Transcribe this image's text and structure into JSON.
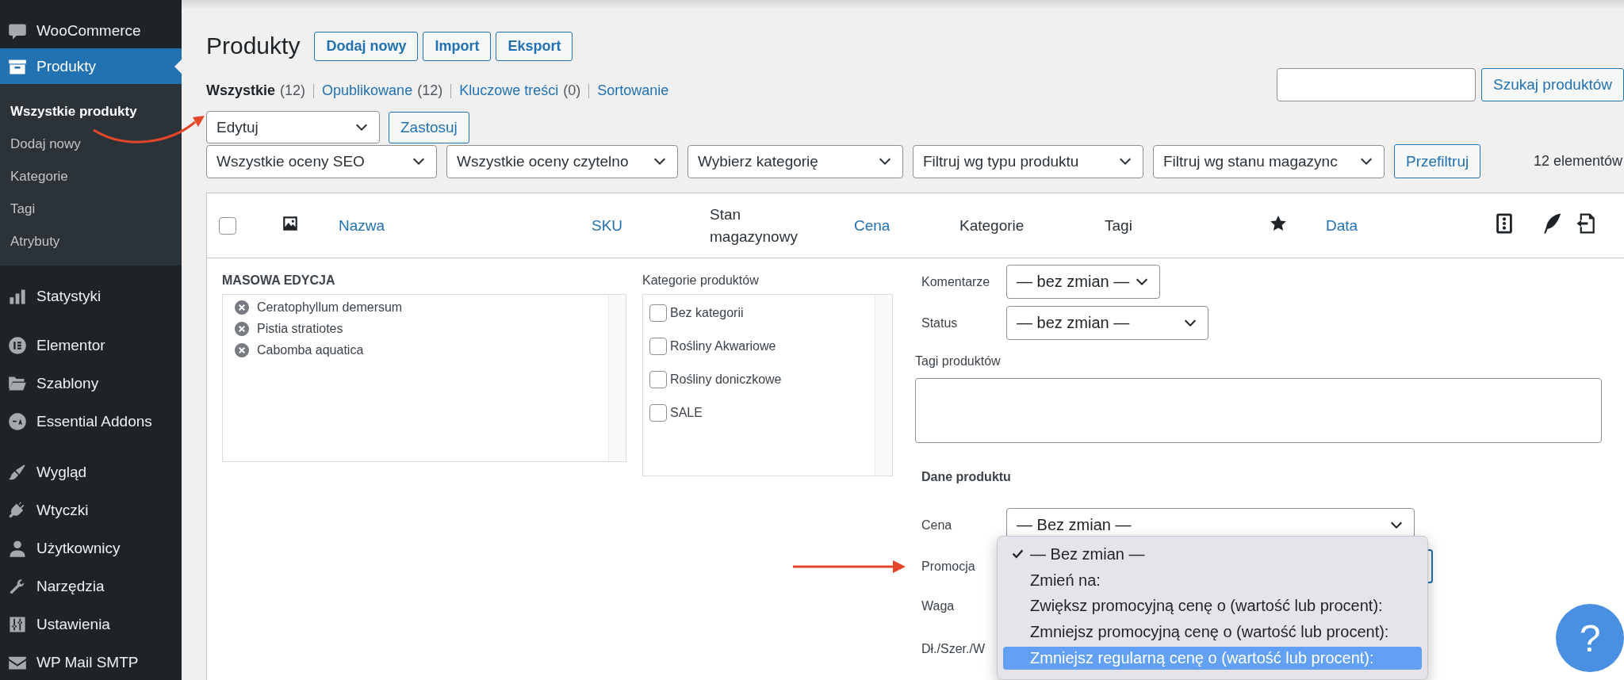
{
  "sidebar": {
    "groups": [
      {
        "items": [
          {
            "label": "WooCommerce",
            "selected": false
          },
          {
            "label": "Produkty",
            "selected": true,
            "children": [
              {
                "label": "Wszystkie produkty",
                "selected": true
              },
              {
                "label": "Dodaj nowy",
                "selected": false
              },
              {
                "label": "Kategorie",
                "selected": false
              },
              {
                "label": "Tagi",
                "selected": false
              },
              {
                "label": "Atrybuty",
                "selected": false
              }
            ]
          }
        ]
      },
      {
        "items": [
          {
            "label": "Statystyki",
            "selected": false
          }
        ]
      },
      {
        "items": [
          {
            "label": "Elementor",
            "selected": false
          },
          {
            "label": "Szablony",
            "selected": false
          },
          {
            "label": "Essential Addons",
            "selected": false
          }
        ]
      },
      {
        "items": [
          {
            "label": "Wygląd",
            "selected": false
          },
          {
            "label": "Wtyczki",
            "selected": false
          },
          {
            "label": "Użytkownicy",
            "selected": false
          },
          {
            "label": "Narzędzia",
            "selected": false
          },
          {
            "label": "Ustawienia",
            "selected": false
          },
          {
            "label": "WP Mail SMTP",
            "selected": false
          }
        ]
      }
    ]
  },
  "page": {
    "title": "Produkty",
    "actions": [
      "Dodaj nowy",
      "Import",
      "Eksport"
    ]
  },
  "views": [
    {
      "label": "Wszystkie",
      "count": "(12)",
      "selected": true
    },
    {
      "label": "Opublikowane",
      "count": "(12)",
      "selected": false
    },
    {
      "label": "Kluczowe treści",
      "count": "(0)",
      "selected": false
    },
    {
      "label": "Sortowanie",
      "selected": false
    }
  ],
  "search": {
    "button": "Szukaj produktów"
  },
  "bulk_actions": {
    "value": "Edytuj",
    "button": "Zastosuj"
  },
  "filters": [
    "Wszystkie oceny SEO",
    "Wszystkie oceny czytelno",
    "Wybierz kategorię",
    "Filtruj wg typu produktu",
    "Filtruj wg stanu magazync"
  ],
  "filter_button": "Przefiltruj",
  "item_count": "12 elementów",
  "table": {
    "columns": [
      {
        "kind": "checkbox",
        "checked": false
      },
      {
        "kind": "icon"
      },
      {
        "kind": "sortable",
        "label": "Nazwa"
      },
      {
        "kind": "sortable",
        "label": "SKU"
      },
      {
        "kind": "plain",
        "label": "Stan magazynowy"
      },
      {
        "kind": "sortable",
        "label": "Cena"
      },
      {
        "kind": "plain",
        "label": "Kategorie"
      },
      {
        "kind": "plain",
        "label": "Tagi"
      },
      {
        "kind": "icon"
      },
      {
        "kind": "sortable",
        "label": "Data"
      },
      {
        "kind": "icon"
      },
      {
        "kind": "icon"
      },
      {
        "kind": "icon"
      }
    ]
  },
  "bulk_edit": {
    "title": "MASOWA EDYCJA",
    "products": [
      "Ceratophyllum demersum",
      "Pistia stratiotes",
      "Cabomba aquatica"
    ],
    "categories_title": "Kategorie produktów",
    "categories": [
      {
        "label": "Bez kategorii",
        "checked": false
      },
      {
        "label": "Rośliny Akwariowe",
        "checked": false
      },
      {
        "label": "Rośliny doniczkowe",
        "checked": false
      },
      {
        "label": "SALE",
        "checked": false
      }
    ],
    "fields": [
      {
        "kind": "select",
        "label": "Komentarze",
        "value": "— bez zmian —",
        "focused": false
      },
      {
        "kind": "select",
        "label": "Status",
        "value": "— bez zmian —",
        "focused": false
      },
      {
        "kind": "textarea",
        "label": "Tagi produktów"
      },
      {
        "kind": "heading",
        "label": "Dane produktu"
      },
      {
        "kind": "select",
        "label": "Cena",
        "value": "— Bez zmian —",
        "focused": false
      },
      {
        "kind": "select",
        "label": "Promocja",
        "focused": true
      },
      {
        "kind": "label",
        "label": "Waga"
      },
      {
        "kind": "label",
        "label": "Dł./Szer./W"
      }
    ],
    "dropdown": {
      "options": [
        {
          "label": "— Bez zmian —",
          "selected": true,
          "highlighted": false
        },
        {
          "label": "Zmień na:",
          "selected": false,
          "highlighted": false
        },
        {
          "label": "Zwiększ promocyjną cenę o (wartość lub procent):",
          "selected": false,
          "highlighted": false
        },
        {
          "label": "Zmniejsz promocyjną cenę o (wartość lub procent):",
          "selected": false,
          "highlighted": false
        },
        {
          "label": "Zmniejsz regularną cenę o (wartość lub procent):",
          "selected": false,
          "highlighted": true
        }
      ]
    }
  },
  "help": {
    "label": "?"
  }
}
